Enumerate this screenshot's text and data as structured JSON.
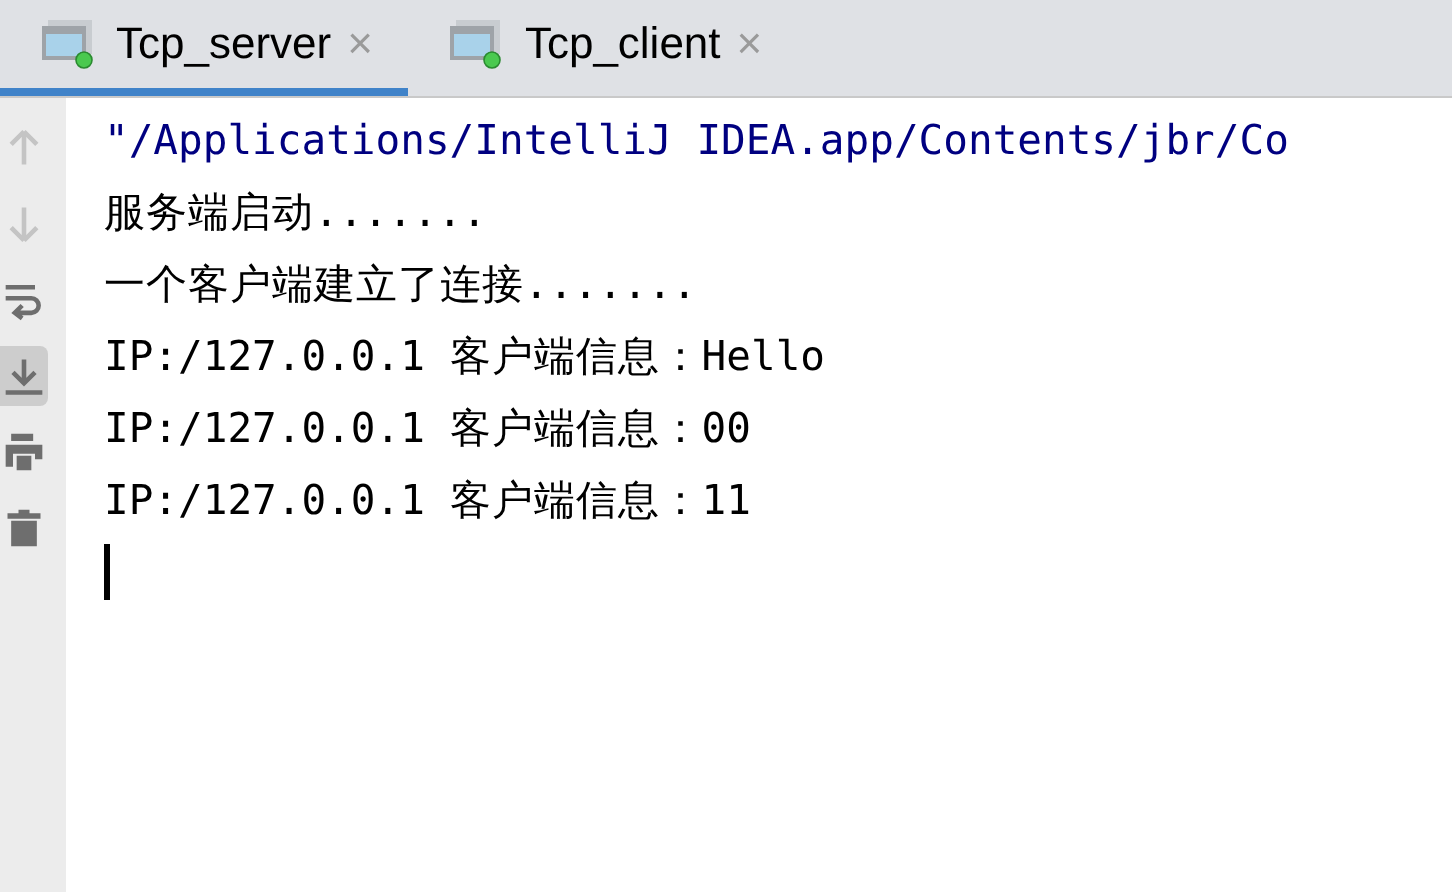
{
  "tabs": [
    {
      "label": "Tcp_server",
      "selected": true,
      "close": "×"
    },
    {
      "label": "Tcp_client",
      "selected": false,
      "close": "×"
    }
  ],
  "toolbar": [
    {
      "kind": "up",
      "disabled": true,
      "selected": false
    },
    {
      "kind": "down",
      "disabled": true,
      "selected": false
    },
    {
      "kind": "wrap",
      "disabled": false,
      "selected": false
    },
    {
      "kind": "scroll",
      "disabled": false,
      "selected": true
    },
    {
      "kind": "print",
      "disabled": false,
      "selected": false
    },
    {
      "kind": "trash",
      "disabled": false,
      "selected": false
    }
  ],
  "console": {
    "lines": [
      {
        "kind": "command",
        "text": "\"/Applications/IntelliJ IDEA.app/Contents/jbr/Co"
      },
      {
        "kind": "output",
        "text": "服务端启动......."
      },
      {
        "kind": "output",
        "text": "一个客户端建立了连接......."
      },
      {
        "kind": "output",
        "text": "IP:/127.0.0.1 客户端信息：Hello"
      },
      {
        "kind": "output",
        "text": "IP:/127.0.0.1 客户端信息：00"
      },
      {
        "kind": "output",
        "text": "IP:/127.0.0.1 客户端信息：11"
      }
    ],
    "caret": true
  }
}
